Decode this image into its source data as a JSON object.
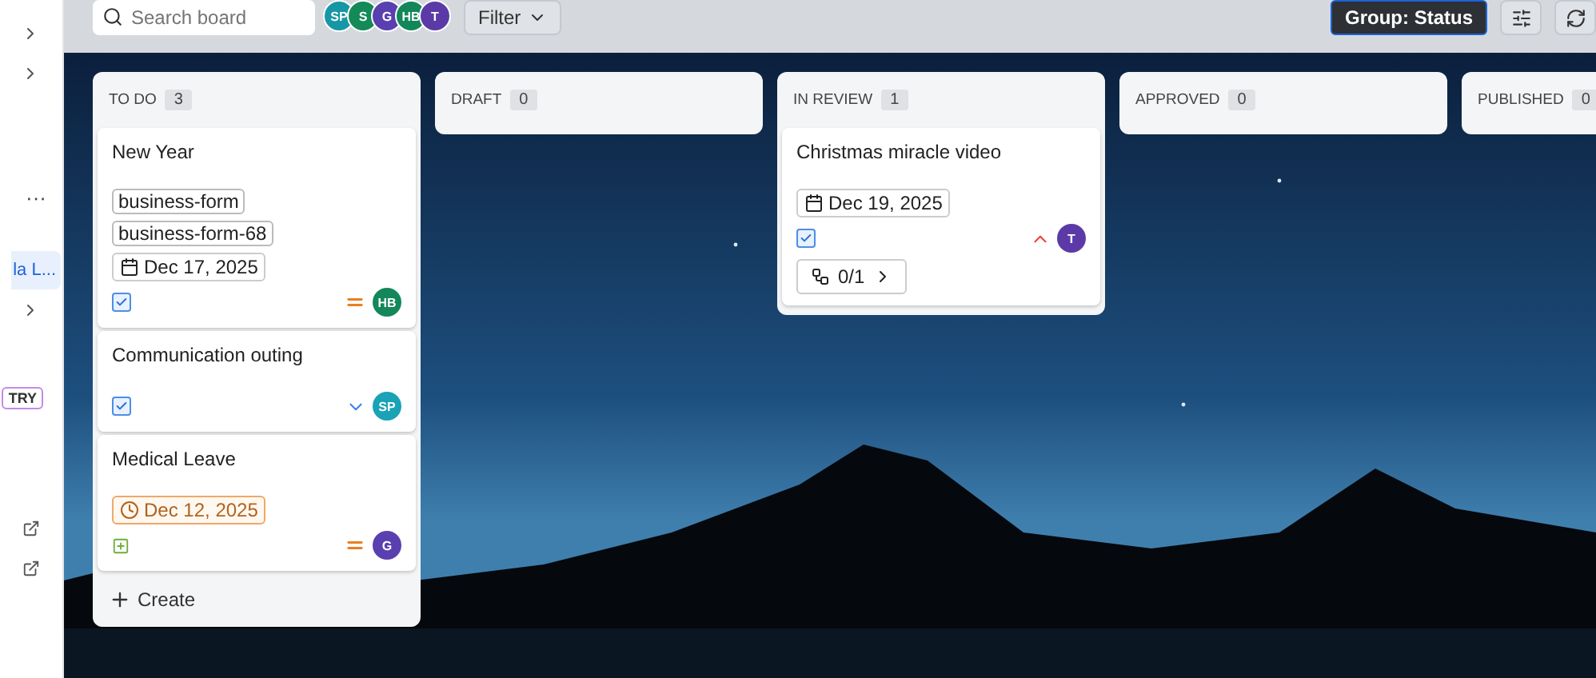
{
  "sidebar": {
    "items": [
      {
        "kind": "chevron"
      },
      {
        "kind": "chevron"
      },
      {
        "kind": "more",
        "label": "···"
      },
      {
        "kind": "link",
        "label": "la L...",
        "selected": true
      },
      {
        "kind": "chevron"
      },
      {
        "kind": "badge",
        "label": "TRY"
      },
      {
        "kind": "external"
      },
      {
        "kind": "external"
      }
    ]
  },
  "toolbar": {
    "search": {
      "placeholder": "Search board"
    },
    "avatars": [
      {
        "initials": "SP",
        "color": "#1796a6"
      },
      {
        "initials": "S",
        "color": "#138a57"
      },
      {
        "initials": "G",
        "color": "#5a3fb0"
      },
      {
        "initials": "HB",
        "color": "#13875a"
      },
      {
        "initials": "T",
        "color": "#5b3aa8"
      }
    ],
    "filter": "Filter",
    "group": "Group: Status"
  },
  "columns": [
    {
      "title": "TO DO",
      "count": "3",
      "create": "Create",
      "cards": [
        {
          "title": "New Year",
          "labels": [
            "business-form",
            "business-form-68"
          ],
          "due": {
            "text": "Dec 17, 2025",
            "overdue": false
          },
          "kind": "task",
          "priority": {
            "kind": "medium"
          },
          "assignee": {
            "initials": "HB",
            "color": "#13875a"
          }
        },
        {
          "title": "Communication outing",
          "kind": "task",
          "priority": {
            "kind": "low"
          },
          "assignee": {
            "initials": "SP",
            "color": "#1aa2b6"
          }
        },
        {
          "title": "Medical Leave",
          "due": {
            "text": "Dec 12, 2025",
            "overdue": true
          },
          "kind": "story",
          "priority": {
            "kind": "medium"
          },
          "assignee": {
            "initials": "G",
            "color": "#5a3fb0"
          }
        }
      ]
    },
    {
      "title": "DRAFT",
      "count": "0"
    },
    {
      "title": "IN REVIEW",
      "count": "1",
      "cards": [
        {
          "title": "Christmas miracle video",
          "due": {
            "text": "Dec 19, 2025",
            "overdue": false
          },
          "kind": "task",
          "priority": {
            "kind": "high"
          },
          "assignee": {
            "initials": "T",
            "color": "#5b3aa8"
          },
          "subtasks": "0/1"
        }
      ]
    },
    {
      "title": "APPROVED",
      "count": "0"
    },
    {
      "title": "PUBLISHED",
      "count": "0"
    }
  ]
}
